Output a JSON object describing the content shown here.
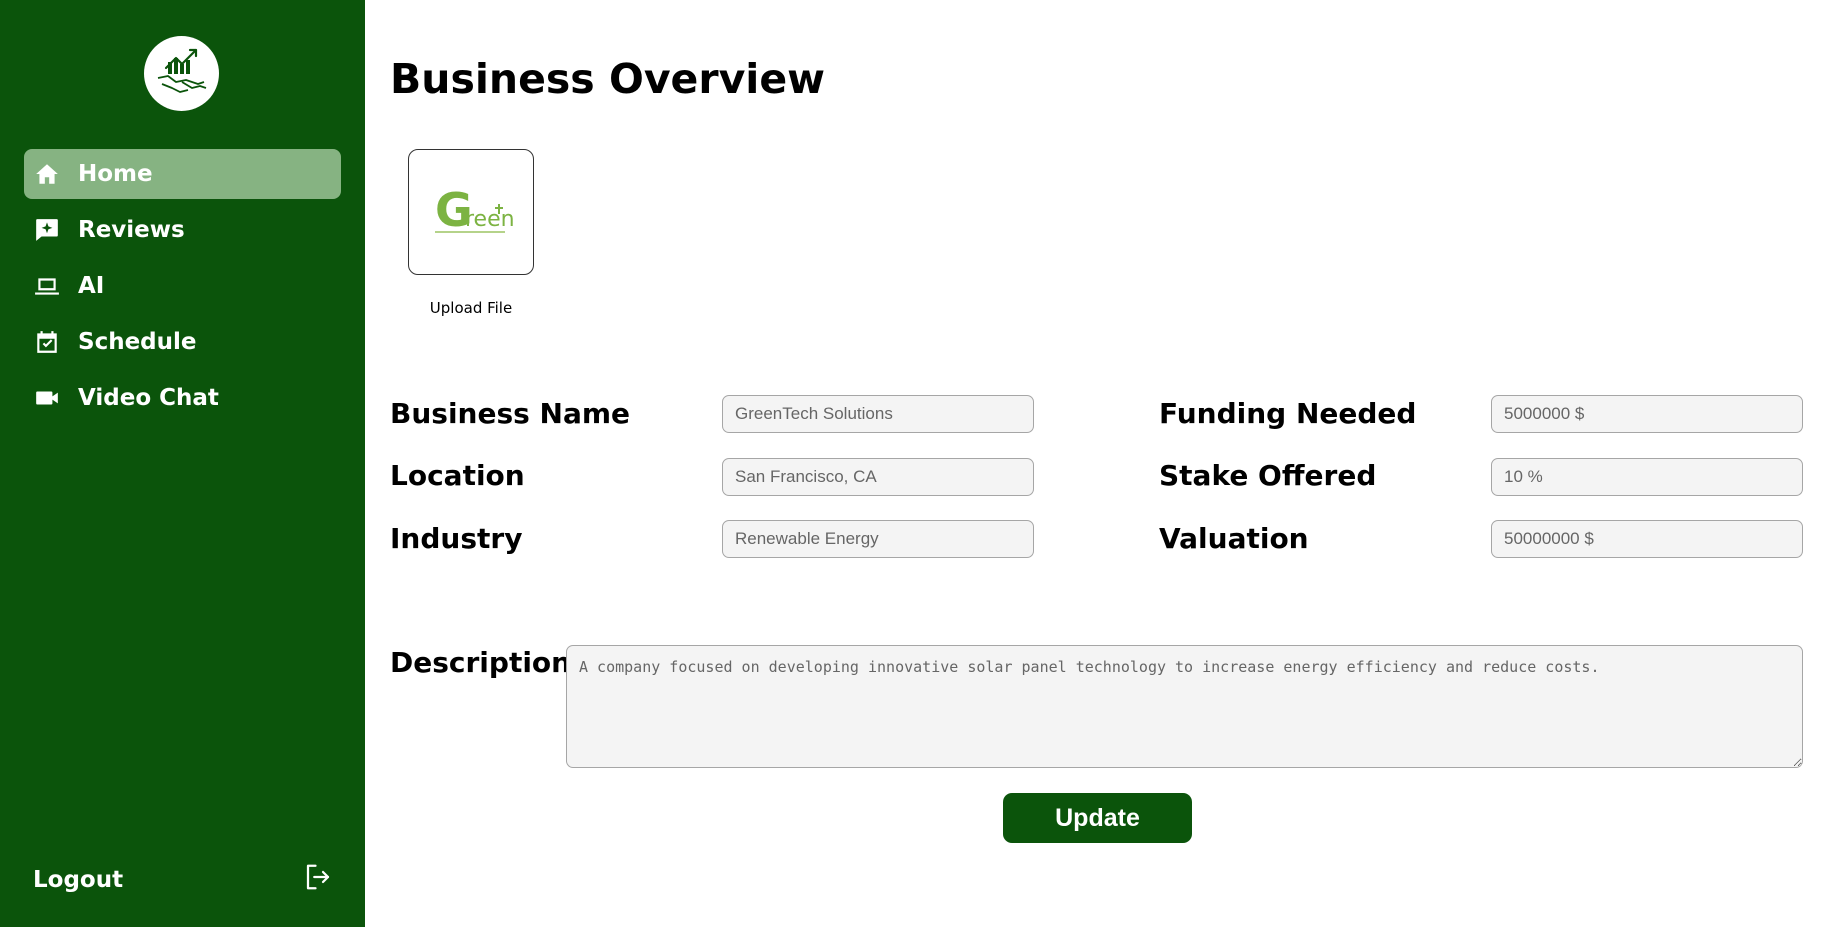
{
  "sidebar": {
    "logo_icon": "business-handshake-growth-logo-icon",
    "items": [
      {
        "label": "Home",
        "icon": "home-icon",
        "active": true
      },
      {
        "label": "Reviews",
        "icon": "review-sparkle-icon",
        "active": false
      },
      {
        "label": "AI",
        "icon": "laptop-icon",
        "active": false
      },
      {
        "label": "Schedule",
        "icon": "calendar-check-icon",
        "active": false
      },
      {
        "label": "Video Chat",
        "icon": "video-camera-icon",
        "active": false
      }
    ],
    "logout_label": "Logout",
    "logout_icon": "logout-icon"
  },
  "main": {
    "title": "Business Overview",
    "upload_label": "Upload File",
    "logo_text": "Green",
    "fields_left": [
      {
        "label": "Business Name",
        "value": "GreenTech Solutions"
      },
      {
        "label": "Location",
        "value": "San Francisco, CA"
      },
      {
        "label": "Industry",
        "value": "Renewable Energy"
      }
    ],
    "fields_right": [
      {
        "label": "Funding Needed",
        "value": "5000000 $"
      },
      {
        "label": "Stake Offered",
        "value": "10 %"
      },
      {
        "label": "Valuation",
        "value": "50000000 $"
      }
    ],
    "description_label": "Description",
    "description_value": "A company focused on developing innovative solar panel technology to increase energy efficiency and reduce costs.",
    "update_label": "Update"
  },
  "colors": {
    "sidebar_bg": "#0b540b",
    "active_item_bg": "#86b382",
    "button_bg": "#0b540b",
    "logo_green": "#7cb342"
  }
}
